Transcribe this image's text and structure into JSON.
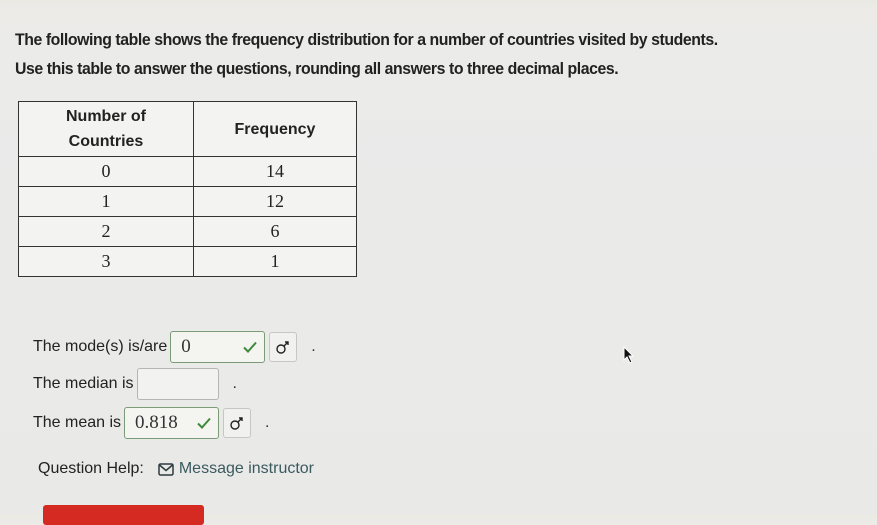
{
  "question": {
    "intro_line1": "The following table shows the frequency distribution for a number of countries visited by students.",
    "intro_line2": "Use this table to answer the questions, rounding all answers to three decimal places."
  },
  "table": {
    "headers": [
      "Number of Countries",
      "Frequency"
    ],
    "header_line1": "Number of",
    "header_line2": "Countries",
    "header_freq": "Frequency",
    "rows": [
      {
        "countries": "0",
        "frequency": "14"
      },
      {
        "countries": "1",
        "frequency": "12"
      },
      {
        "countries": "2",
        "frequency": "6"
      },
      {
        "countries": "3",
        "frequency": "1"
      }
    ]
  },
  "answers": {
    "mode": {
      "label": "The mode(s) is/are",
      "value": "0",
      "status": "correct"
    },
    "median": {
      "label": "The median is",
      "value": "",
      "status": "empty"
    },
    "mean": {
      "label": "The mean is",
      "value": "0.818",
      "status": "correct"
    },
    "period": "."
  },
  "help": {
    "label": "Question Help:",
    "message_link": "Message instructor"
  },
  "colors": {
    "correct_check": "#3f8a3a",
    "submit_button": "#d42a22",
    "link": "#3b5a5e"
  }
}
